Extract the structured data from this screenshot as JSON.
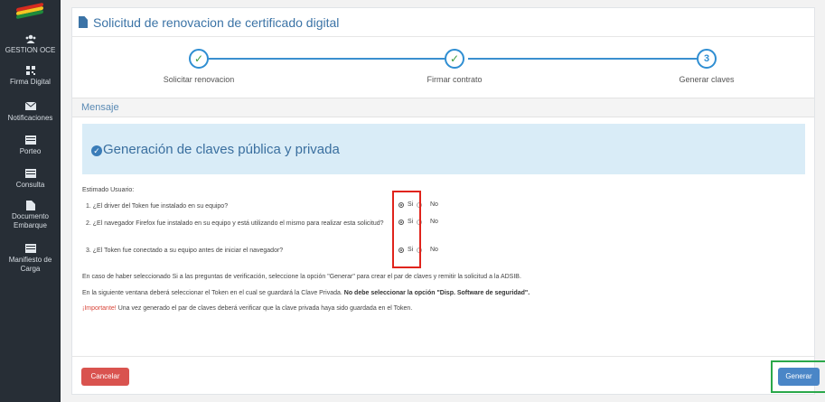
{
  "sidebar": {
    "items": [
      {
        "label": "GESTION OCE",
        "icon": "users-icon"
      },
      {
        "label": "Firma Digital",
        "icon": "qr-icon"
      },
      {
        "label": "Notificaciones",
        "icon": "envelope-icon"
      },
      {
        "label": "Porteo",
        "icon": "card-icon"
      },
      {
        "label": "Consulta",
        "icon": "card-icon"
      },
      {
        "label": "Documento Embarque",
        "icon": "document-icon"
      },
      {
        "label": "Manifiesto de Carga",
        "icon": "card-icon"
      }
    ]
  },
  "page": {
    "title": "Solicitud de renovacion de certificado digital"
  },
  "wizard": {
    "steps": [
      {
        "label": "Solicitar renovacion",
        "state": "done",
        "mark": "✓"
      },
      {
        "label": "Firmar contrato",
        "state": "done",
        "mark": "✓"
      },
      {
        "label": "Generar claves",
        "state": "current",
        "mark": "3"
      }
    ]
  },
  "mensaje": {
    "title": "Mensaje",
    "header": "Generación de claves pública y privada",
    "greeting": "Estimado Usuario:",
    "questions": [
      {
        "text": "1. ¿El driver del Token fue instalado en su equipo?",
        "si": "Si",
        "no": "No",
        "selected": "Si"
      },
      {
        "text": "2. ¿El navegador Firefox fue instalado en su equipo y está utilizando el mismo para realizar esta solicitud?",
        "si": "Si",
        "no": "No",
        "selected": "Si"
      },
      {
        "text": "3. ¿El Token fue conectado a su equipo antes de iniciar el navegador?",
        "si": "Si",
        "no": "No",
        "selected": "Si"
      }
    ],
    "para1": "En caso de haber seleccionado Si a las preguntas de verificación, seleccione la opción \"Generar\" para crear el par de claves y remitir la solicitud a la ADSIB.",
    "para2_a": "En la siguiente ventana deberá seleccionar el Token en el cual se guardará la Clave Privada. ",
    "para2_b": "No debe seleccionar la opción \"Disp. Software de seguridad\".",
    "para3_a": "¡Importante!",
    "para3_b": " Una vez generado el par de claves deberá verificar que la clave privada haya sido guardada en el Token."
  },
  "footer": {
    "cancel_label": "Cancelar",
    "generate_label": "Generar"
  },
  "colors": {
    "accent": "#3b73a6",
    "cancel": "#d9534f",
    "generate": "#4a86c7",
    "highlight_red": "#e0241c",
    "highlight_green": "#2aa84a"
  }
}
